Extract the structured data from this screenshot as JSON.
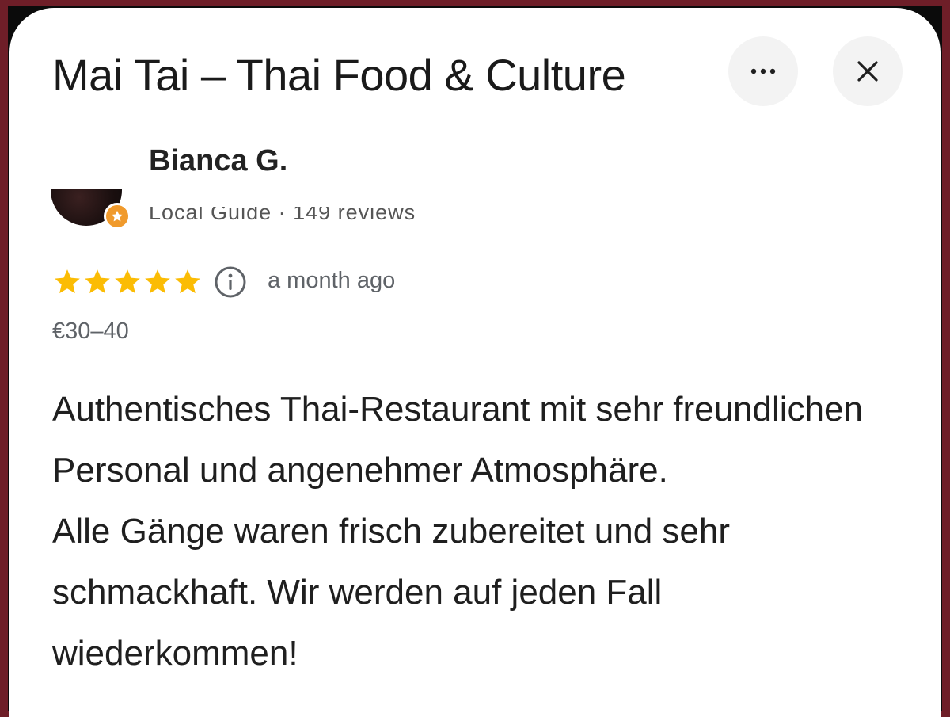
{
  "place": {
    "title": "Mai Tai – Thai Food & Culture"
  },
  "header": {
    "more_icon": "more-horizontal-icon",
    "close_icon": "close-icon"
  },
  "review": {
    "author": "Bianca G.",
    "author_meta": "Local Guide · 149 reviews",
    "badge_icon": "local-guide-star-icon",
    "rating": 5,
    "rating_max": 5,
    "time": "a month ago",
    "price_range": "€30–40",
    "text": "Authentisches Thai-Restaurant mit sehr freundlichen Personal und angenehmer Atmosphäre.\nAlle Gänge waren frisch zubereitet und sehr schmackhaft. Wir werden auf jeden Fall wiederkommen!"
  },
  "colors": {
    "frame": "#6e1e28",
    "star": "#fbbc04",
    "badge": "#f09a2c",
    "muted_text": "#5f6368"
  }
}
